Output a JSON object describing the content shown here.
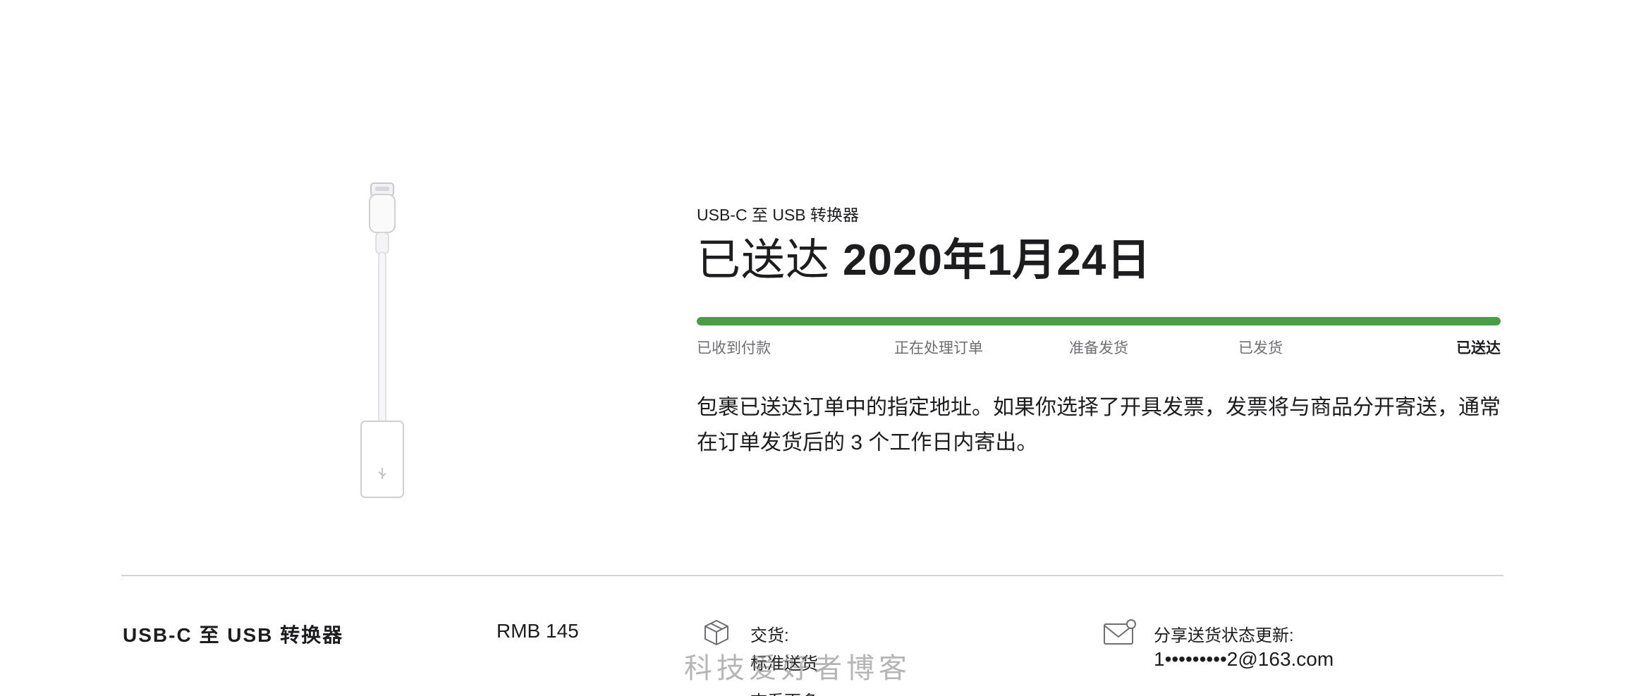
{
  "order_item": {
    "product_name": "USB-C 至 USB 转换器",
    "status_word": "已送达",
    "status_date": "2020年1月24日",
    "progress_fraction": 1.0,
    "progress_color": "#4a9c45",
    "steps": [
      "已收到付款",
      "正在处理订单",
      "准备发货",
      "已发货",
      "已送达"
    ],
    "current_step_index": 4,
    "description": "包裹已送达订单中的指定地址。如果你选择了开具发票，发票将与商品分开寄送，通常在订单发货后的 3 个工作日内寄出。"
  },
  "summary": {
    "product_name": "USB-C 至 USB 转换器",
    "price": "RMB 145",
    "delivery_label": "交货:",
    "delivery_method": "标准送货",
    "more_label": "查看更多",
    "share_label": "分享送货状态更新:",
    "share_email": "1•••••••••2@163.com",
    "delivery_icon": "package-icon",
    "share_icon": "mail-icon"
  },
  "watermark": "科技爱好者博客"
}
